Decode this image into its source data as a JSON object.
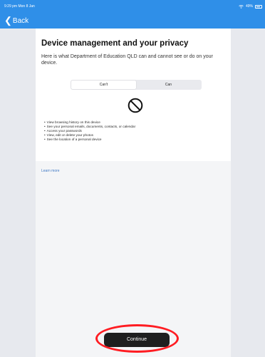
{
  "status_bar": {
    "time": "9:29 pm  Mon 8 Jan",
    "battery": "49%"
  },
  "nav": {
    "back_label": "Back"
  },
  "content": {
    "title": "Device management and your privacy",
    "subtitle": "Here is what Department of Education QLD can and cannot see or do on your device.",
    "tabs": [
      {
        "label": "Can't",
        "active": true
      },
      {
        "label": "Can",
        "active": false
      }
    ],
    "cant_items": [
      "View browsing history on this device",
      "See your personal emails, documents, contacts, or calendar",
      "Access your passwords",
      "View, edit or delete your photos",
      "See the location of a personal device"
    ],
    "learn_more": "Learn more"
  },
  "footer": {
    "continue_label": "Continue"
  },
  "colors": {
    "header_blue": "#2f8fe8",
    "annotation_red": "#ff1c22",
    "button_dark": "#1f1f1f"
  },
  "icons": {
    "wifi": "wifi-icon",
    "battery": "battery-icon",
    "back": "chevron-left-icon",
    "prohibited": "prohibited-icon"
  }
}
